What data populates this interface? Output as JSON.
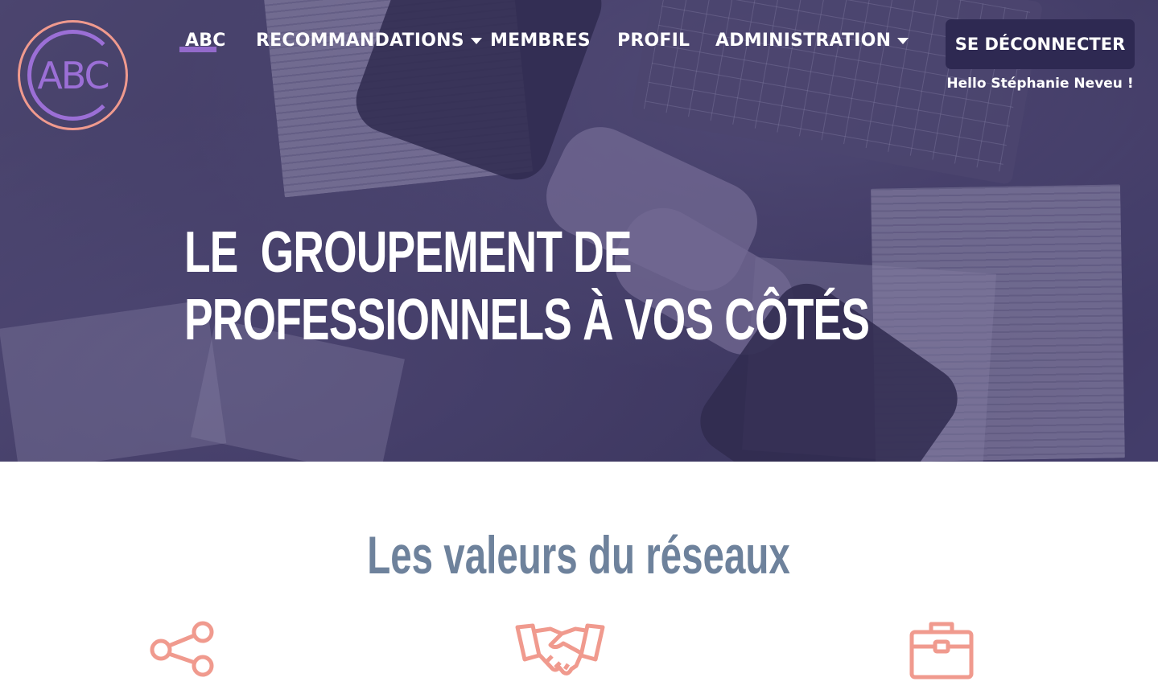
{
  "brand": {
    "logo_text": "ABC",
    "accent": "#9b6fd6",
    "ring": "#f09a8e"
  },
  "nav": {
    "items": [
      {
        "label": "ABC",
        "dropdown": false,
        "active": true
      },
      {
        "label": "RECOMMANDATIONS",
        "dropdown": true
      },
      {
        "label": "MEMBRES",
        "dropdown": false
      },
      {
        "label": "PROFIL",
        "dropdown": false
      },
      {
        "label": "ADMINISTRATION",
        "dropdown": true
      }
    ],
    "logout_label": "SE DÉCONNECTER",
    "greeting": "Hello Stéphanie Neveu !"
  },
  "hero": {
    "title_line1": "LE  GROUPEMENT DE",
    "title_line2": "PROFESSIONNELS À VOS CÔTÉS",
    "overlay_color": "#3a3464"
  },
  "values": {
    "title": "Les valeurs du réseaux",
    "icons": [
      "share-icon",
      "handshake-icon",
      "briefcase-icon"
    ],
    "icon_color": "#f09a8e"
  }
}
